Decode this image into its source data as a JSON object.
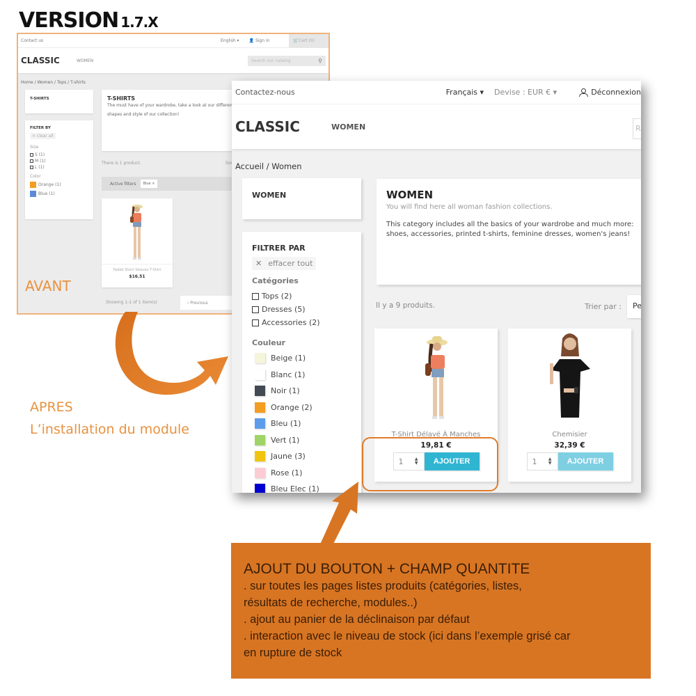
{
  "version": {
    "label": "VERSION",
    "number": "1.7.X"
  },
  "before": {
    "topbar": {
      "contact": "Contact us",
      "language": "English ▾",
      "signin": "Sign in",
      "cart": "Cart (0)"
    },
    "header": {
      "logo": "CLASSIC",
      "nav_women": "WOMEN",
      "search_placeholder": "Search our catalog"
    },
    "breadcrumb": "Home  /  Women  /  Tops  /  T-shirts",
    "sidebar_category": "T-SHIRTS",
    "filter": {
      "title": "FILTER BY",
      "clear_all": "× clear all",
      "size_label": "Size",
      "sizes": [
        "S (1)",
        "M (1)",
        "L (1)"
      ],
      "color_label": "Color",
      "colors": [
        {
          "label": "Orange (1)",
          "color": "#f39d21"
        },
        {
          "label": "Blue (1)",
          "color": "#5d8ad6"
        }
      ]
    },
    "category": {
      "title": "T-SHIRTS",
      "line1": "The must have of your wardrobe, take a look at our different colors,",
      "line2": "shapes and style of our collection!"
    },
    "product_count": "There is 1 product.",
    "sort_label": "Sort by:",
    "active_filters": {
      "label": "Active filters",
      "chip": "Blue ×"
    },
    "product": {
      "name": "Faded Short Sleeves T-Shirt",
      "price": "$16.51"
    },
    "showing": "Showing 1-1 of 1 item(s)",
    "previous": "‹  Previous",
    "caption": "AVANT"
  },
  "after": {
    "topbar": {
      "contact": "Contactez-nous",
      "language": "Français ▾",
      "currency": "Devise : EUR € ▾",
      "account": "Déconnexion"
    },
    "header": {
      "logo": "CLASSIC",
      "nav_women": "WOMEN",
      "search_stub": "R"
    },
    "breadcrumb": "Accueil  /  Women",
    "sidebar_category": "WOMEN",
    "filter": {
      "title": "FILTRER PAR",
      "clear_all": "effacer tout",
      "categories_label": "Catégories",
      "categories": [
        "Tops (2)",
        "Dresses (5)",
        "Accessories (2)"
      ],
      "color_label": "Couleur",
      "colors": [
        {
          "label": "Beige (1)",
          "color": "#f5f5dc"
        },
        {
          "label": "Blanc (1)",
          "color": "#ffffff"
        },
        {
          "label": "Noir (1)",
          "color": "#434a54"
        },
        {
          "label": "Orange (2)",
          "color": "#f39d21"
        },
        {
          "label": "Bleu (1)",
          "color": "#5d9cec"
        },
        {
          "label": "Vert (1)",
          "color": "#a0d468"
        },
        {
          "label": "Jaune (3)",
          "color": "#f1c40f"
        },
        {
          "label": "Rose (1)",
          "color": "#fcccd4"
        },
        {
          "label": "Bleu Elec (1)",
          "color": "#0000d0"
        }
      ]
    },
    "category": {
      "title": "WOMEN",
      "subtitle": "You will find here all woman fashion collections.",
      "body": "This category includes all the basics of your wardrobe and much more: shoes, accessories, printed t-shirts, feminine dresses, women's jeans!"
    },
    "product_count": "Il y a 9 produits.",
    "sort_label": "Trier par :",
    "sort_value": "Pe",
    "products": [
      {
        "name": "T-Shirt Délavé À Manches",
        "price": "19,81 €",
        "qty": "1",
        "button": "AJOUTER",
        "in_stock": true
      },
      {
        "name": "Chemisier",
        "price": "32,39 €",
        "qty": "1",
        "button": "AJOUTER",
        "in_stock": false
      }
    ]
  },
  "apres": {
    "line1": "APRES",
    "line2": "L’installation du module"
  },
  "callout": {
    "title": "AJOUT DU BOUTON + CHAMP QUANTITE",
    "lines": [
      ". sur toutes les pages listes produits (catégories, listes,",
      "résultats de recherche, modules..)",
      ". ajout au panier de la déclinaison par défaut",
      ". interaction avec le niveau de stock (ici dans l’exemple grisé car",
      "en rupture de stock"
    ]
  },
  "colors": {
    "accent_orange": "#d87523",
    "button_blue": "#2fb5d2",
    "button_blue_disabled": "#7fcfe3"
  }
}
